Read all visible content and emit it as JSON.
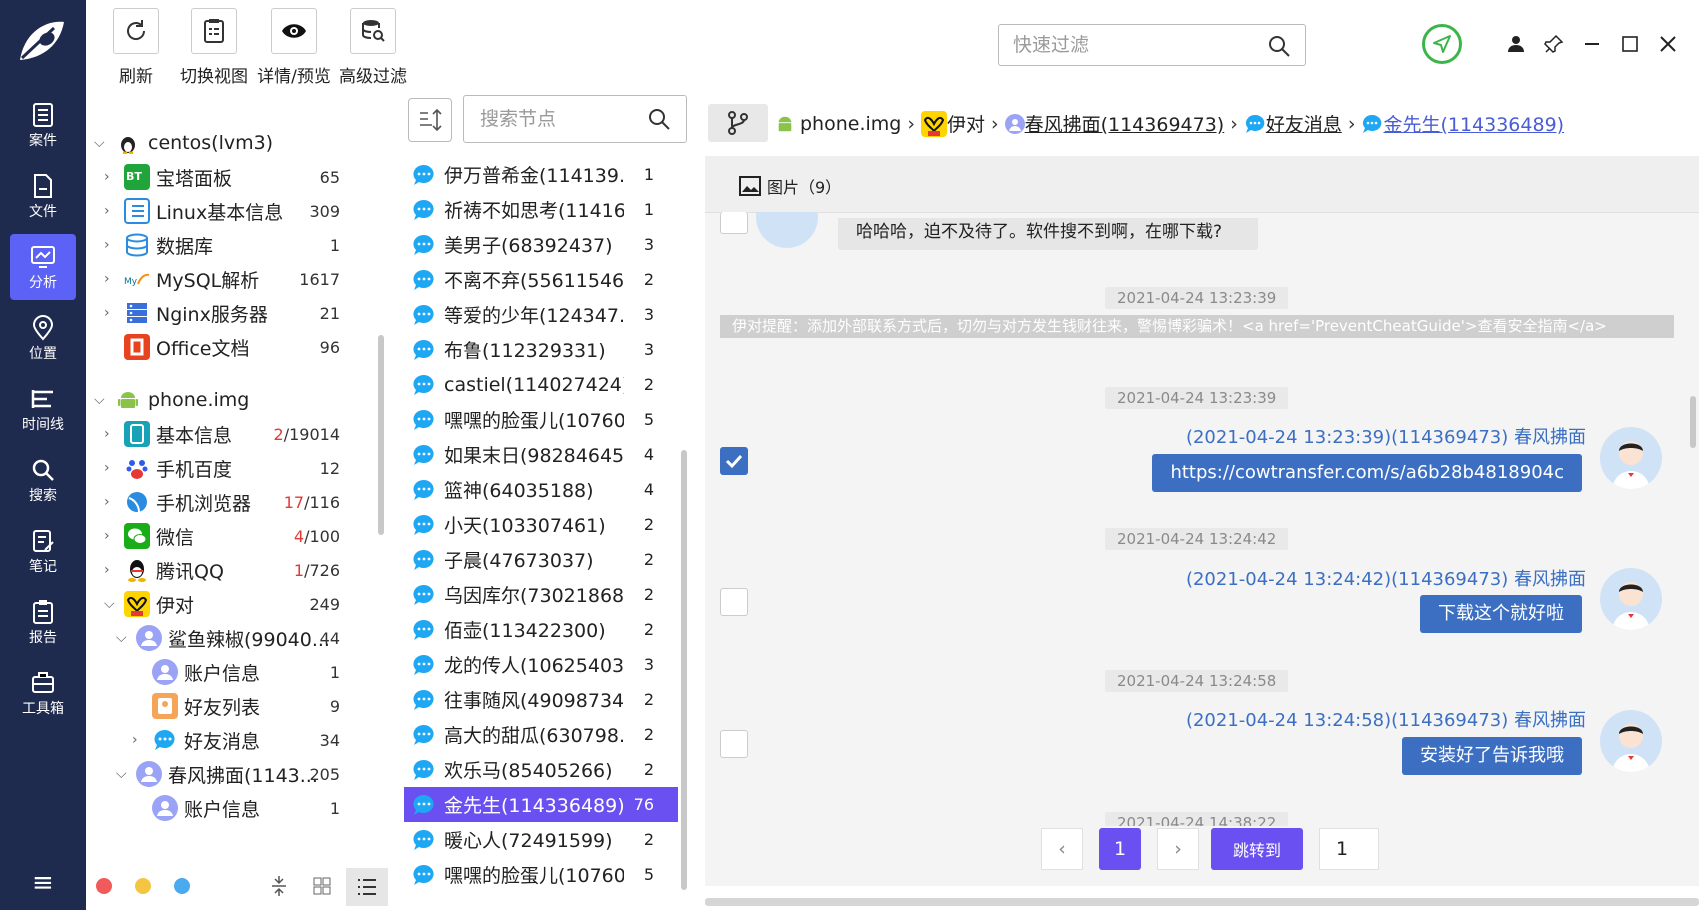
{
  "nav": {
    "items": [
      {
        "label": "案件",
        "icon": "case-icon"
      },
      {
        "label": "文件",
        "icon": "file-icon"
      },
      {
        "label": "分析",
        "icon": "analysis-icon"
      },
      {
        "label": "位置",
        "icon": "location-icon"
      },
      {
        "label": "时间线",
        "icon": "timeline-icon"
      },
      {
        "label": "搜索",
        "icon": "search-icon"
      },
      {
        "label": "笔记",
        "icon": "note-icon"
      },
      {
        "label": "报告",
        "icon": "report-icon"
      },
      {
        "label": "工具箱",
        "icon": "toolbox-icon"
      }
    ],
    "active": "分析"
  },
  "toolbar": {
    "refresh": "刷新",
    "switch_view": "切换视图",
    "detail_preview": "详情/预览",
    "advanced_filter": "高级过滤",
    "quick_filter_placeholder": "快速过滤"
  },
  "tree": {
    "rows": [
      {
        "label": "centos(lvm3)",
        "count": ""
      },
      {
        "label": "宝塔面板",
        "count": "65"
      },
      {
        "label": "Linux基本信息",
        "count": "309"
      },
      {
        "label": "数据库",
        "count": "1"
      },
      {
        "label": "MySQL解析",
        "count": "1617"
      },
      {
        "label": "Nginx服务器",
        "count": "21"
      },
      {
        "label": "Office文档",
        "count": "96"
      },
      {
        "label": "phone.img",
        "count": ""
      },
      {
        "label": "基本信息",
        "count_red": "2",
        "count": "/19014"
      },
      {
        "label": "手机百度",
        "count": "12"
      },
      {
        "label": "手机浏览器",
        "count_red": "17",
        "count": "/116"
      },
      {
        "label": "微信",
        "count_red": "4",
        "count": "/100"
      },
      {
        "label": "腾讯QQ",
        "count_red": "1",
        "count": "/726"
      },
      {
        "label": "伊对",
        "count": "249"
      },
      {
        "label": "鲨鱼辣椒(99040...",
        "count": "44"
      },
      {
        "label": "账户信息",
        "count": "1"
      },
      {
        "label": "好友列表",
        "count": "9"
      },
      {
        "label": "好友消息",
        "count": "34"
      },
      {
        "label": "春风拂面(1143...",
        "count": "205"
      },
      {
        "label": "账户信息",
        "count": "1"
      }
    ]
  },
  "contacts": {
    "search_placeholder": "搜索节点",
    "rows": [
      {
        "name": "伊万普希金(114139...",
        "count": "1"
      },
      {
        "name": "祈祷不如思考(11416...",
        "count": "1"
      },
      {
        "name": "美男子(68392437)",
        "count": "3"
      },
      {
        "name": "不离不弃(55611546)",
        "count": "2"
      },
      {
        "name": "等爱的少年(124347...",
        "count": "3"
      },
      {
        "name": "布鲁(112329331)",
        "count": "3"
      },
      {
        "name": "castiel(114027424)",
        "count": "2"
      },
      {
        "name": "嘿嘿的脸蛋儿(10760...",
        "count": "5"
      },
      {
        "name": "如果末日(98284645)",
        "count": "4"
      },
      {
        "name": "篮神(64035188)",
        "count": "4"
      },
      {
        "name": "小天(103307461)",
        "count": "2"
      },
      {
        "name": "子晨(47673037)",
        "count": "2"
      },
      {
        "name": "乌因库尔(73021868)",
        "count": "2"
      },
      {
        "name": "佰壶(113422300)",
        "count": "2"
      },
      {
        "name": "龙的传人(106254036)",
        "count": "3"
      },
      {
        "name": "往事随风(49098734)",
        "count": "2"
      },
      {
        "name": "高大的甜瓜(630798...",
        "count": "2"
      },
      {
        "name": "欢乐马(85405266)",
        "count": "2"
      },
      {
        "name": "金先生(114336489)",
        "count": "76"
      },
      {
        "name": "暖心人(72491599)",
        "count": "2"
      },
      {
        "name": "嘿嘿的脸蛋儿(10760...",
        "count": "5"
      }
    ],
    "selected": "金先生(114336489)"
  },
  "breadcrumb": {
    "root": "phone.img",
    "app": "伊对",
    "account": "春风拂面(114369473)",
    "category": "好友消息",
    "contact": "金先生(114336489)"
  },
  "images_tab": "图片（9）",
  "chat": {
    "top_message": "哈哈哈，迫不及待了。软件搜不到啊，在哪下载?",
    "warning": "伊对提醒：添加外部联系方式后，切勿与对方发生钱财往来，警惕博彩骗术！<a href='PreventCheatGuide'>查看安全指南</a>",
    "timestamps": [
      "2021-04-24 13:23:39",
      "2021-04-24 13:23:39",
      "2021-04-24 13:24:42",
      "2021-04-24 13:24:58",
      "2021-04-24 14:38:22"
    ],
    "messages": [
      {
        "sender": "(2021-04-24 13:23:39)(114369473) 春风拂面",
        "text": "https://cowtransfer.com/s/a6b28b4818904c",
        "checked": true
      },
      {
        "sender": "(2021-04-24 13:24:42)(114369473) 春风拂面",
        "text": "下载这个就好啦",
        "checked": false
      },
      {
        "sender": "(2021-04-24 13:24:58)(114369473) 春风拂面",
        "text": "安装好了告诉我哦",
        "checked": false
      }
    ]
  },
  "pager": {
    "current": "1",
    "jump_label": "跳转到",
    "jump_value": "1"
  },
  "colors": {
    "nav_bg": "#1f2a4f",
    "accent": "#5b62f5",
    "selected_row": "#6a50f0",
    "bubble": "#3c6fc2",
    "green": "#3bb54a"
  }
}
